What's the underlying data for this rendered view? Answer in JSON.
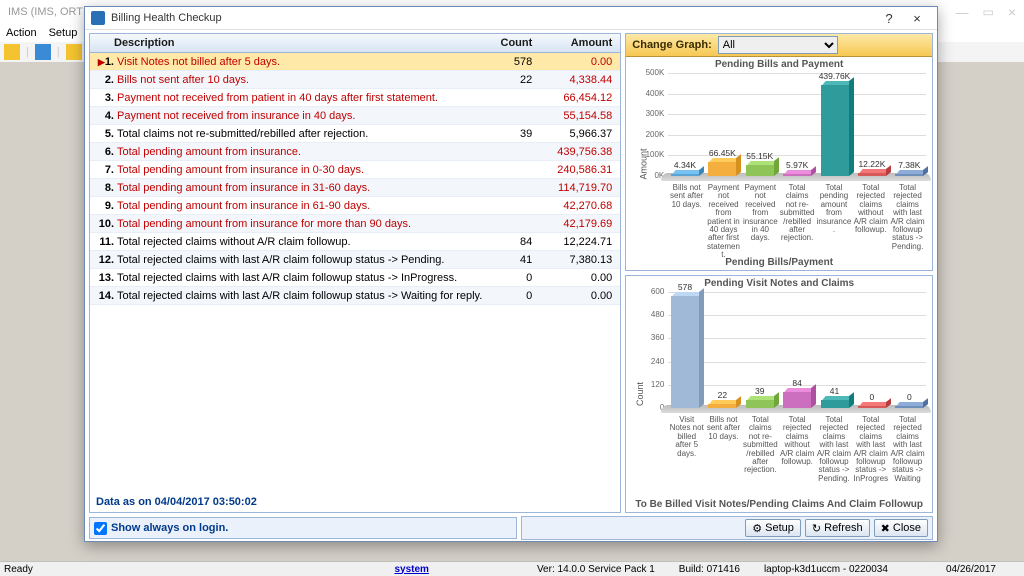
{
  "app": {
    "title": "IMS (IMS, ORTHO...)",
    "menu": [
      "Action",
      "Setup"
    ]
  },
  "dialog": {
    "title": "Billing Health Checkup",
    "table": {
      "headers": {
        "desc": "Description",
        "count": "Count",
        "amount": "Amount"
      },
      "rows": [
        {
          "n": "1.",
          "desc": "Visit Notes not billed after 5 days.",
          "count": "578",
          "amount": "0.00",
          "red": true,
          "selected": true,
          "arrow": true
        },
        {
          "n": "2.",
          "desc": "Bills not sent after 10 days.",
          "count": "22",
          "amount": "4,338.44",
          "red": true
        },
        {
          "n": "3.",
          "desc": "Payment not received from patient in 40 days after first statement.",
          "count": "",
          "amount": "66,454.12",
          "red": true
        },
        {
          "n": "4.",
          "desc": "Payment not received from insurance in 40 days.",
          "count": "",
          "amount": "55,154.58",
          "red": true
        },
        {
          "n": "5.",
          "desc": "Total claims not re-submitted/rebilled after rejection.",
          "count": "39",
          "amount": "5,966.37",
          "red": false
        },
        {
          "n": "6.",
          "desc": "Total pending amount from insurance.",
          "count": "",
          "amount": "439,756.38",
          "red": true
        },
        {
          "n": "7.",
          "desc": "Total pending amount from insurance in 0-30 days.",
          "count": "",
          "amount": "240,586.31",
          "red": true
        },
        {
          "n": "8.",
          "desc": "Total pending amount from insurance in 31-60 days.",
          "count": "",
          "amount": "114,719.70",
          "red": true
        },
        {
          "n": "9.",
          "desc": "Total pending amount from insurance in 61-90 days.",
          "count": "",
          "amount": "42,270.68",
          "red": true
        },
        {
          "n": "10.",
          "desc": "Total pending amount from insurance for more than 90 days.",
          "count": "",
          "amount": "42,179.69",
          "red": true
        },
        {
          "n": "11.",
          "desc": "Total rejected claims without A/R claim followup.",
          "count": "84",
          "amount": "12,224.71",
          "red": false
        },
        {
          "n": "12.",
          "desc": "Total rejected claims with last A/R claim followup status -> Pending.",
          "count": "41",
          "amount": "7,380.13",
          "red": false
        },
        {
          "n": "13.",
          "desc": "Total rejected claims with last A/R claim followup status -> InProgress.",
          "count": "0",
          "amount": "0.00",
          "red": false
        },
        {
          "n": "14.",
          "desc": "Total rejected claims with last A/R claim followup status -> Waiting for reply.",
          "count": "0",
          "amount": "0.00",
          "red": false
        }
      ],
      "asof": "Data as on 04/04/2017 03:50:02"
    },
    "graph": {
      "label": "Change Graph:",
      "selected": "All"
    },
    "chart1": {
      "title": "Pending Bills and Payment",
      "ylabel": "Amount",
      "sub": "Pending Bills/Payment"
    },
    "chart2": {
      "title": "Pending Visit Notes and Claims",
      "ylabel": "Count",
      "sub": "To Be Billed Visit Notes/Pending Claims And Claim Followup"
    },
    "footer": {
      "showAlways": "Show always on login.",
      "setup": "Setup",
      "refresh": "Refresh",
      "close": "Close"
    }
  },
  "status": {
    "ready": "Ready",
    "system": "system",
    "ver": "Ver: 14.0.0 Service Pack 1",
    "build": "Build: 071416",
    "host": "laptop-k3d1uccm - 0220034",
    "date": "04/26/2017"
  },
  "chart_data": [
    {
      "type": "bar",
      "title": "Pending Bills and Payment",
      "ylabel": "Amount",
      "ylim": [
        0,
        500000
      ],
      "yticks": [
        0,
        100000,
        200000,
        300000,
        400000,
        500000
      ],
      "categories": [
        "Bills not sent after 10 days.",
        "Payment not received from patient in 40 days after first statement.",
        "Payment not received from insurance in 40 days.",
        "Total claims not re-submitted/rebilled after rejection.",
        "Total pending amount from insurance.",
        "Total rejected claims without A/R claim followup.",
        "Total rejected claims with last A/R claim followup status -> Pending."
      ],
      "values": [
        4338.44,
        66454.12,
        55154.58,
        5966.37,
        439756.38,
        12224.71,
        7380.13
      ],
      "labels": [
        "4.34K",
        "66.45K",
        "55.15K",
        "5.97K",
        "439.76K",
        "12.22K",
        "7.38K"
      ],
      "colors": [
        "#5aa4d5",
        "#f3ae3d",
        "#8fc458",
        "#cc6fbf",
        "#2f9b9b",
        "#d65a5a",
        "#6f8fba"
      ]
    },
    {
      "type": "bar",
      "title": "Pending Visit Notes and Claims",
      "ylabel": "Count",
      "ylim": [
        0,
        600
      ],
      "yticks": [
        0,
        120,
        240,
        360,
        480,
        600
      ],
      "categories": [
        "Visit Notes not billed after 5 days.",
        "Bills not sent after 10 days.",
        "Total claims not re-submitted/rebilled after rejection.",
        "Total rejected claims without A/R claim followup.",
        "Total rejected claims with last A/R claim followup status -> Pending.",
        "Total rejected claims with last A/R claim followup status -> InProgres",
        "Total rejected claims with last A/R claim followup status -> Waiting"
      ],
      "values": [
        578,
        22,
        39,
        84,
        41,
        0,
        0
      ],
      "labels": [
        "578",
        "22",
        "39",
        "84",
        "41",
        "0",
        "0"
      ],
      "colors": [
        "#9fb9d6",
        "#f3ae3d",
        "#8fc458",
        "#cc6fbf",
        "#2f9b9b",
        "#d65a5a",
        "#6f8fba"
      ]
    }
  ]
}
